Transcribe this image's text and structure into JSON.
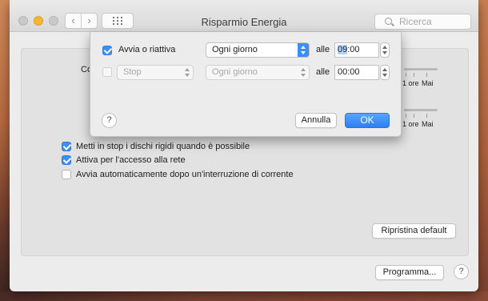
{
  "window": {
    "title": "Risparmio Energia",
    "search_placeholder": "Ricerca",
    "back_glyph": "‹",
    "forward_glyph": "›"
  },
  "panel": {
    "partial_label": "Co",
    "sliders": [
      {
        "labels": [
          "1 ore",
          "Mai"
        ]
      },
      {
        "labels": [
          "1 ore",
          "Mai"
        ]
      }
    ],
    "checkboxes": [
      {
        "label": "Metti in stop i dischi rigidi quando è possibile",
        "checked": true
      },
      {
        "label": "Attiva per l'accesso alla rete",
        "checked": true
      },
      {
        "label": "Avvia automaticamente dopo un'interruzione di corrente",
        "checked": false
      }
    ],
    "restore_button": "Ripristina default",
    "schedule_button": "Programma...",
    "help_glyph": "?"
  },
  "sheet": {
    "rows": [
      {
        "checked": true,
        "action": "Avvia o riattiva",
        "action_is_popup": false,
        "frequency": "Ogni giorno",
        "at_label": "alle",
        "time_hours": "09",
        "time_rest": ":00"
      },
      {
        "checked": false,
        "action": "Stop",
        "action_is_popup": true,
        "frequency": "Ogni giorno",
        "at_label": "alle",
        "time_hours": "00",
        "time_rest": ":00"
      }
    ],
    "cancel_button": "Annulla",
    "ok_button": "OK",
    "help_glyph": "?"
  },
  "colors": {
    "accent": "#3c8ef5",
    "window_bg": "#ececec"
  },
  "icons": [
    "back-icon",
    "forward-icon",
    "grid-icon",
    "search-icon",
    "help-icon",
    "checkmark-icon",
    "popup-arrows-icon",
    "stepper-icon"
  ]
}
